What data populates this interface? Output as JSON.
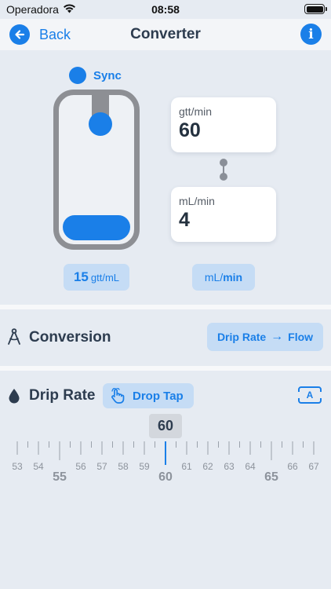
{
  "status_bar": {
    "carrier": "Operadora",
    "time": "08:58",
    "icons": [
      "wifi-icon",
      "battery-icon"
    ]
  },
  "nav": {
    "back_label": "Back",
    "title": "Converter",
    "info_icon": "i"
  },
  "sync": {
    "label": "Sync"
  },
  "drip_chamber": {
    "fill_fraction": 0.17
  },
  "cards": {
    "drops": {
      "unit": "gtt/min",
      "value": "60"
    },
    "flow": {
      "unit": "mL/min",
      "value": "4"
    }
  },
  "drop_factor": {
    "value": "15",
    "unit": "gtt/mL"
  },
  "flow_unit": {
    "left": "mL/",
    "right": "min"
  },
  "conversion": {
    "label": "Conversion",
    "from": "Drip Rate",
    "to": "Flow"
  },
  "drip_rate": {
    "label": "Drip Rate",
    "tap_label": "Drop Tap",
    "auto_label": "A",
    "current": "60",
    "ruler": {
      "min": 53,
      "max": 67,
      "value": 60,
      "minor_labels": [
        "53",
        "54",
        "56",
        "57",
        "58",
        "59",
        "61",
        "62",
        "63",
        "64",
        "66",
        "67"
      ],
      "major_labels": [
        "55",
        "60",
        "65"
      ]
    }
  },
  "colors": {
    "accent": "#1a7fe8",
    "pill": "#c5dcf5",
    "background": "#e6ebf2",
    "chamber": "#8d8f94"
  }
}
